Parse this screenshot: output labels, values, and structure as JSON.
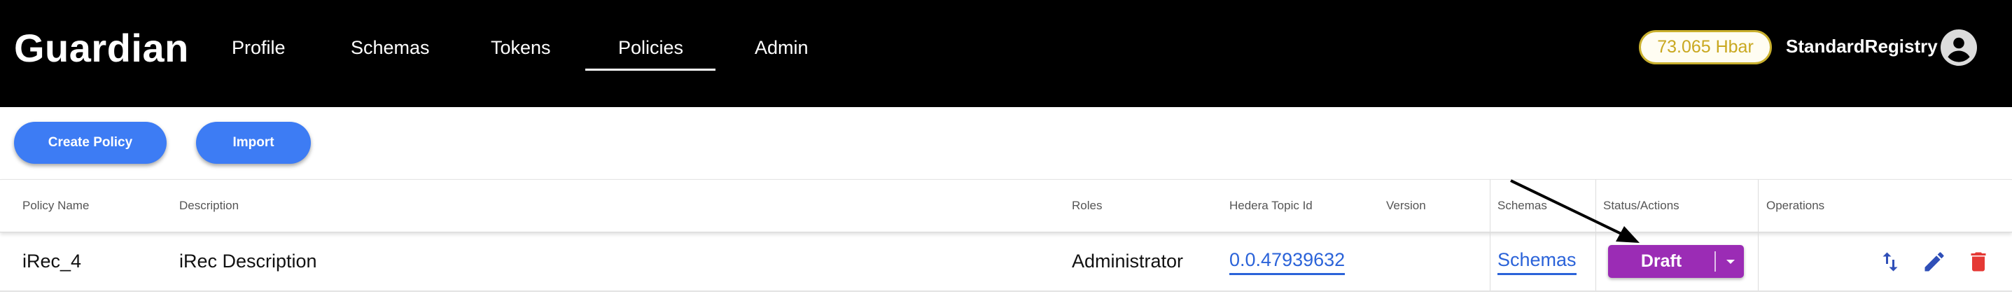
{
  "header": {
    "logo": "Guardian",
    "nav": [
      {
        "label": "Profile"
      },
      {
        "label": "Schemas"
      },
      {
        "label": "Tokens"
      },
      {
        "label": "Policies",
        "active": true
      },
      {
        "label": "Admin"
      }
    ],
    "balance": "73.065 Hbar",
    "username": "StandardRegistry",
    "avatar_icon": "account-circle-icon"
  },
  "toolbar": {
    "create_label": "Create Policy",
    "import_label": "Import"
  },
  "table": {
    "columns": [
      "Policy Name",
      "Description",
      "Roles",
      "Hedera Topic Id",
      "Version",
      "Schemas",
      "Status/Actions",
      "Operations"
    ],
    "rows": [
      {
        "name": "iRec_4",
        "description": "iRec Description",
        "roles": "Administrator",
        "topic_id": "0.0.47939632",
        "version": "",
        "schemas": "Schemas",
        "status": "Draft",
        "operations": [
          "swap-vert-icon",
          "edit-icon",
          "delete-icon"
        ]
      }
    ]
  },
  "colors": {
    "header_bg": "#000000",
    "primary_button": "#3d7cf4",
    "status_draft": "#9b2cb5",
    "balance_border": "#c9b02e",
    "link": "#2b63d9",
    "delete": "#e53935",
    "icon_blue": "#2f4fb8"
  }
}
